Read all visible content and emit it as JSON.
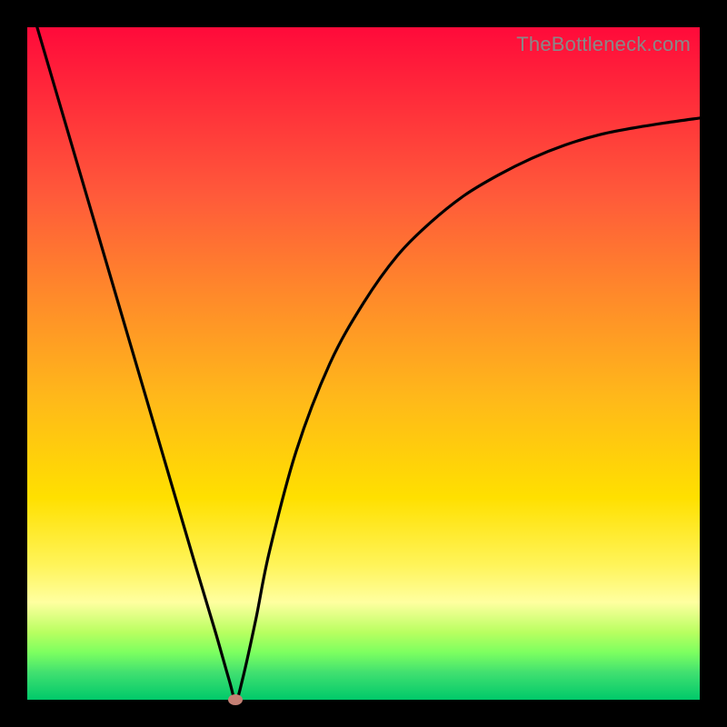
{
  "watermark": "TheBottleneck.com",
  "colors": {
    "frame": "#000000",
    "curve": "#000000",
    "marker": "#c58074",
    "gradient_stops": [
      {
        "pos": 0.0,
        "color": "#ff0a3a"
      },
      {
        "pos": 0.1,
        "color": "#ff2a3a"
      },
      {
        "pos": 0.25,
        "color": "#ff5a3a"
      },
      {
        "pos": 0.4,
        "color": "#ff8a2a"
      },
      {
        "pos": 0.55,
        "color": "#ffb81a"
      },
      {
        "pos": 0.7,
        "color": "#ffe000"
      },
      {
        "pos": 0.8,
        "color": "#fff45a"
      },
      {
        "pos": 0.855,
        "color": "#ffffa0"
      },
      {
        "pos": 0.9,
        "color": "#b8ff60"
      },
      {
        "pos": 0.93,
        "color": "#7cff60"
      },
      {
        "pos": 0.96,
        "color": "#40e070"
      },
      {
        "pos": 1.0,
        "color": "#00c96a"
      }
    ]
  },
  "chart_data": {
    "type": "line",
    "title": "",
    "xlabel": "",
    "ylabel": "",
    "xlim": [
      0,
      100
    ],
    "ylim": [
      0,
      100
    ],
    "series": [
      {
        "name": "bottleneck-curve",
        "x": [
          0,
          5,
          10,
          15,
          20,
          25,
          28,
          30,
          31,
          32,
          34,
          36,
          40,
          45,
          50,
          55,
          60,
          65,
          70,
          75,
          80,
          85,
          90,
          95,
          100
        ],
        "y": [
          105,
          88,
          71,
          54,
          37,
          20,
          10,
          3,
          0,
          3,
          12,
          22,
          37,
          50,
          59,
          66,
          71,
          75,
          78,
          80.5,
          82.5,
          84,
          85,
          85.8,
          86.5
        ]
      }
    ],
    "marker": {
      "x": 31,
      "y": 0,
      "name": "optimal-point"
    }
  }
}
